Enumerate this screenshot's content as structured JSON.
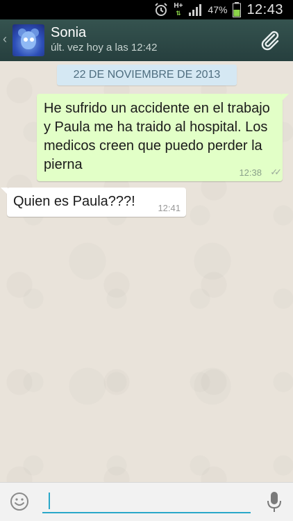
{
  "statusbar": {
    "network": "H+",
    "battery_percent": "47%",
    "clock": "12:43",
    "icons": [
      "alarm-icon",
      "signal-icon",
      "battery-icon"
    ]
  },
  "header": {
    "contact_name": "Sonia",
    "last_seen": "últ. vez hoy a las 12:42",
    "icons": [
      "back-chevron-icon",
      "avatar",
      "paperclip-icon"
    ]
  },
  "chat": {
    "date_label": "22 DE NOVIEMBRE DE 2013",
    "messages": [
      {
        "direction": "outgoing",
        "text": "He sufrido un accidente en el trabajo y Paula me ha traido al hospital. Los medicos creen que puedo perder la pierna",
        "time": "12:38",
        "status": "read-double-check"
      },
      {
        "direction": "incoming",
        "text": "Quien es Paula???!",
        "time": "12:41"
      }
    ]
  },
  "composer": {
    "value": "",
    "icons": [
      "smiley-icon",
      "microphone-icon"
    ]
  },
  "colors": {
    "header_bg": "#2c4b4a",
    "outgoing_bubble": "#e2ffc7",
    "incoming_bubble": "#ffffff",
    "date_chip_bg": "#d5e8f3",
    "input_accent": "#2aa8c9"
  }
}
